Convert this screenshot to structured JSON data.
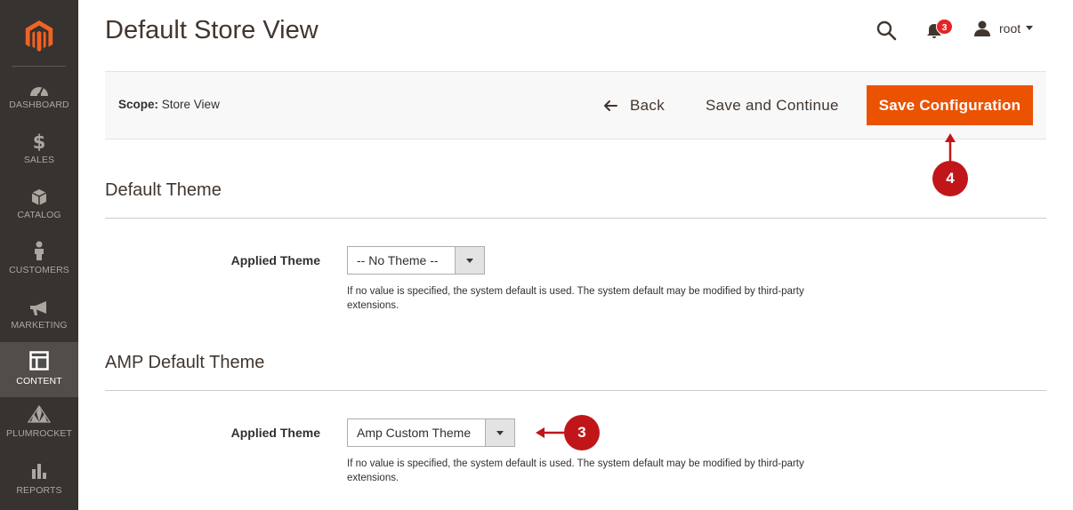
{
  "sidebar": {
    "items": [
      {
        "label": "DASHBOARD",
        "icon": "dashboard-icon"
      },
      {
        "label": "SALES",
        "icon": "dollar-icon"
      },
      {
        "label": "CATALOG",
        "icon": "box-icon"
      },
      {
        "label": "CUSTOMERS",
        "icon": "person-icon"
      },
      {
        "label": "MARKETING",
        "icon": "megaphone-icon"
      },
      {
        "label": "CONTENT",
        "icon": "layout-icon",
        "active": true
      },
      {
        "label": "PLUMROCKET",
        "icon": "plumrocket-icon"
      },
      {
        "label": "REPORTS",
        "icon": "bar-chart-icon"
      }
    ]
  },
  "header": {
    "title": "Default Store View",
    "notifications_count": "3",
    "user_name": "root"
  },
  "actions": {
    "scope_label": "Scope:",
    "scope_value": "Store View",
    "back_label": "Back",
    "save_continue_label": "Save and Continue",
    "save_config_label": "Save Configuration"
  },
  "sections": [
    {
      "title": "Default Theme",
      "field_label": "Applied Theme",
      "selected_value": "-- No Theme --",
      "note": "If no value is specified, the system default is used. The system default may be modified by third-party extensions."
    },
    {
      "title": "AMP Default Theme",
      "field_label": "Applied Theme",
      "selected_value": "Amp Custom Theme",
      "note": "If no value is specified, the system default is used. The system default may be modified by third-party extensions."
    }
  ],
  "callouts": {
    "step_save": "4",
    "step_theme": "3"
  },
  "colors": {
    "sidebar_bg": "#373330",
    "sidebar_active": "#524d49",
    "primary_button": "#eb5202",
    "logo": "#f26322",
    "callout": "#c0161a",
    "badge": "#e22626"
  }
}
